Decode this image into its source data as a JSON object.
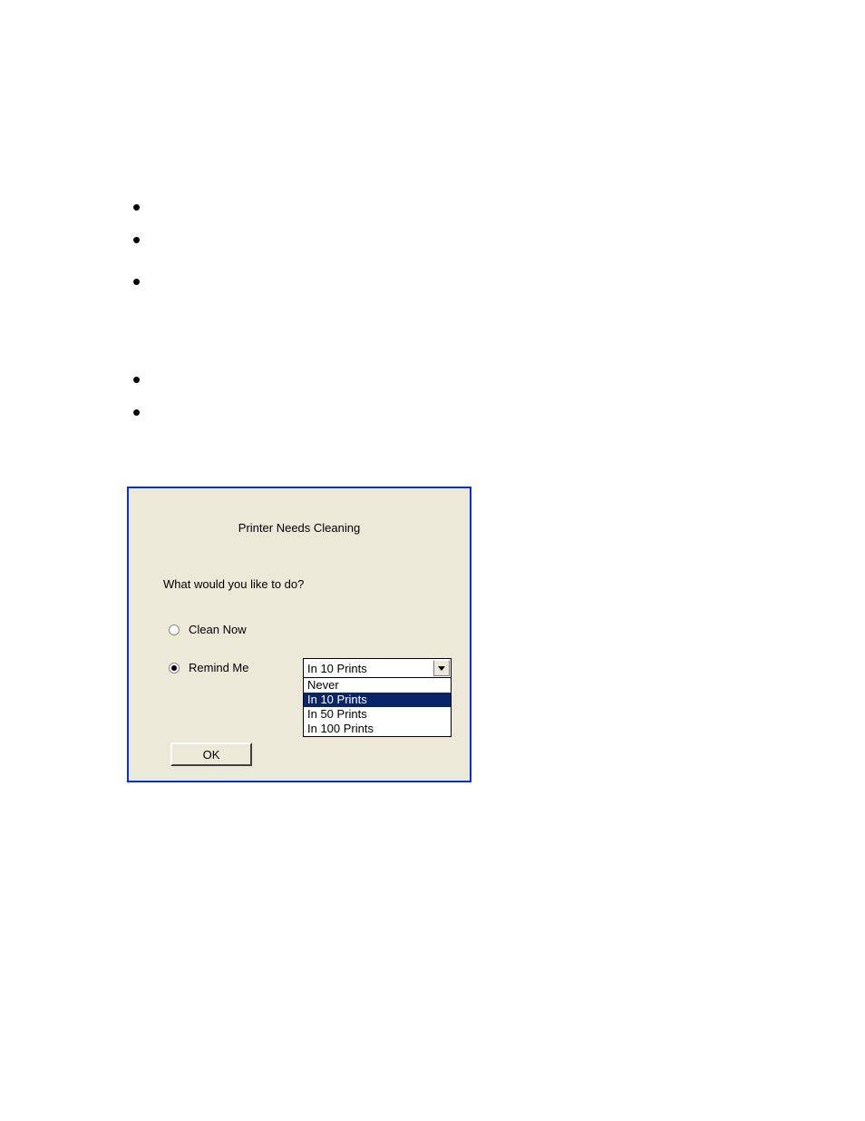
{
  "dialog": {
    "title": "Printer Needs Cleaning",
    "question": "What would you like to do?",
    "options": {
      "clean_now": "Clean Now",
      "remind_me": "Remind Me"
    },
    "combo": {
      "selected": "In 10 Prints",
      "items": [
        "Never",
        "In 10 Prints",
        "In 50 Prints",
        "In 100 Prints"
      ]
    },
    "ok": "OK"
  }
}
